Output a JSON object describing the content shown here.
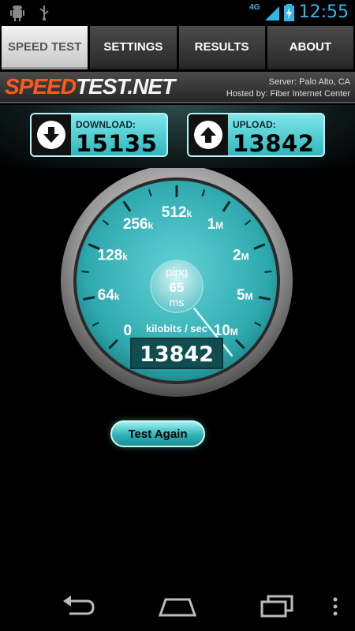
{
  "status_bar": {
    "network_label": "4G",
    "clock": "12:55",
    "icons": [
      "android-debug-icon",
      "usb-icon",
      "signal-icon",
      "battery-charging-icon"
    ]
  },
  "tabs": [
    {
      "label": "SPEED TEST",
      "active": true
    },
    {
      "label": "SETTINGS",
      "active": false
    },
    {
      "label": "RESULTS",
      "active": false
    },
    {
      "label": "ABOUT",
      "active": false
    }
  ],
  "brand": {
    "logo_part1": "SPEED",
    "logo_part2": "TEST.NET",
    "server": "Server: Palo Alto, CA",
    "hosted": "Hosted by: Fiber Internet Center"
  },
  "download": {
    "title": "DOWNLOAD:",
    "value": "15135",
    "icon": "download-arrow-icon"
  },
  "upload": {
    "title": "UPLOAD:",
    "value": "13842",
    "icon": "upload-arrow-icon"
  },
  "gauge": {
    "scale_labels": [
      {
        "num": "0",
        "unit": ""
      },
      {
        "num": "64",
        "unit": "k"
      },
      {
        "num": "128",
        "unit": "k"
      },
      {
        "num": "256",
        "unit": "k"
      },
      {
        "num": "512",
        "unit": "k"
      },
      {
        "num": "1",
        "unit": "M"
      },
      {
        "num": "2",
        "unit": "M"
      },
      {
        "num": "5",
        "unit": "M"
      },
      {
        "num": "10",
        "unit": "M"
      }
    ],
    "ping_label": "ping",
    "ping_value": "65",
    "ping_unit": "ms",
    "units_label": "kilobits / sec",
    "readout": "13842",
    "needle_value_kbps": 13842
  },
  "test_again": "Test Again",
  "colors": {
    "accent": "#33b5e5",
    "teal": "#2fb7bd",
    "brand_orange": "#ff5a1a"
  }
}
